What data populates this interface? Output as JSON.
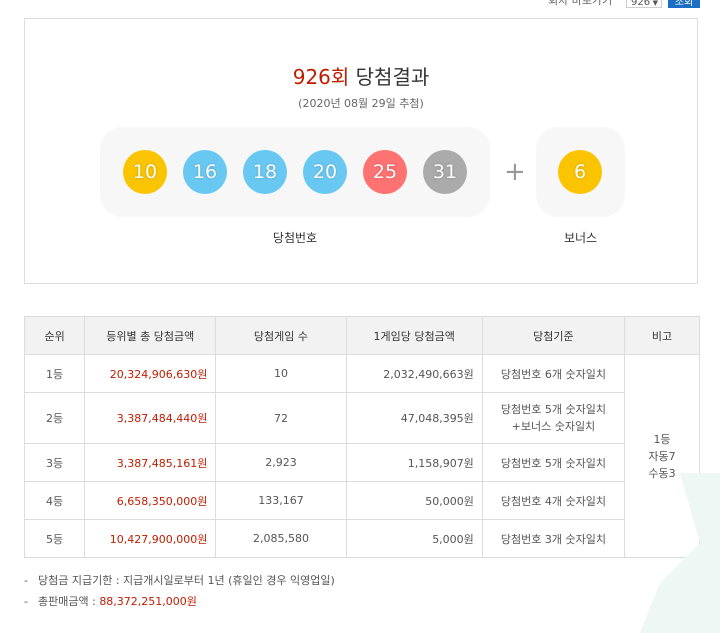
{
  "top": {
    "label": "회차 바로가기",
    "selected_round": "926",
    "go_label": "조회"
  },
  "result": {
    "round": "926회",
    "title": "당첨결과",
    "date": "(2020년 08월 29일 추첨)",
    "numbers": [
      {
        "value": "10",
        "color": "#fbc400"
      },
      {
        "value": "16",
        "color": "#69c8f2"
      },
      {
        "value": "18",
        "color": "#69c8f2"
      },
      {
        "value": "20",
        "color": "#69c8f2"
      },
      {
        "value": "25",
        "color": "#ff7272"
      },
      {
        "value": "31",
        "color": "#aaaaaa"
      }
    ],
    "bonus": {
      "value": "6",
      "color": "#fbc400"
    },
    "winning_label": "당첨번호",
    "bonus_label": "보너스"
  },
  "table": {
    "headers": [
      "순위",
      "등위별 총 당첨금액",
      "당첨게임 수",
      "1게임당 당첨금액",
      "당첨기준",
      "비고"
    ],
    "rows": [
      {
        "rank": "1등",
        "total": "20,324,906,630원",
        "games": "10",
        "per_game": "2,032,490,663원",
        "criteria": "당첨번호 6개 숫자일치"
      },
      {
        "rank": "2등",
        "total": "3,387,484,440원",
        "games": "72",
        "per_game": "47,048,395원",
        "criteria": "당첨번호 5개 숫자일치",
        "criteria2": "+보너스 숫자일치"
      },
      {
        "rank": "3등",
        "total": "3,387,485,161원",
        "games": "2,923",
        "per_game": "1,158,907원",
        "criteria": "당첨번호 5개 숫자일치"
      },
      {
        "rank": "4등",
        "total": "6,658,350,000원",
        "games": "133,167",
        "per_game": "50,000원",
        "criteria": "당첨번호 4개 숫자일치"
      },
      {
        "rank": "5등",
        "total": "10,427,900,000원",
        "games": "2,085,580",
        "per_game": "5,000원",
        "criteria": "당첨번호 3개 숫자일치"
      }
    ],
    "remarks": [
      "1등",
      "자동7",
      "수동3"
    ]
  },
  "notes": {
    "dash": "-",
    "deadline": "당첨금 지급기한 : 지급개시일로부터 1년 (휴일인 경우 익영업일)",
    "sales_label": "총판매금액 : ",
    "sales_value": "88,372,251,000원"
  },
  "colors": {
    "accent_red": "#c01c00",
    "button_blue": "#1a6fc4"
  }
}
